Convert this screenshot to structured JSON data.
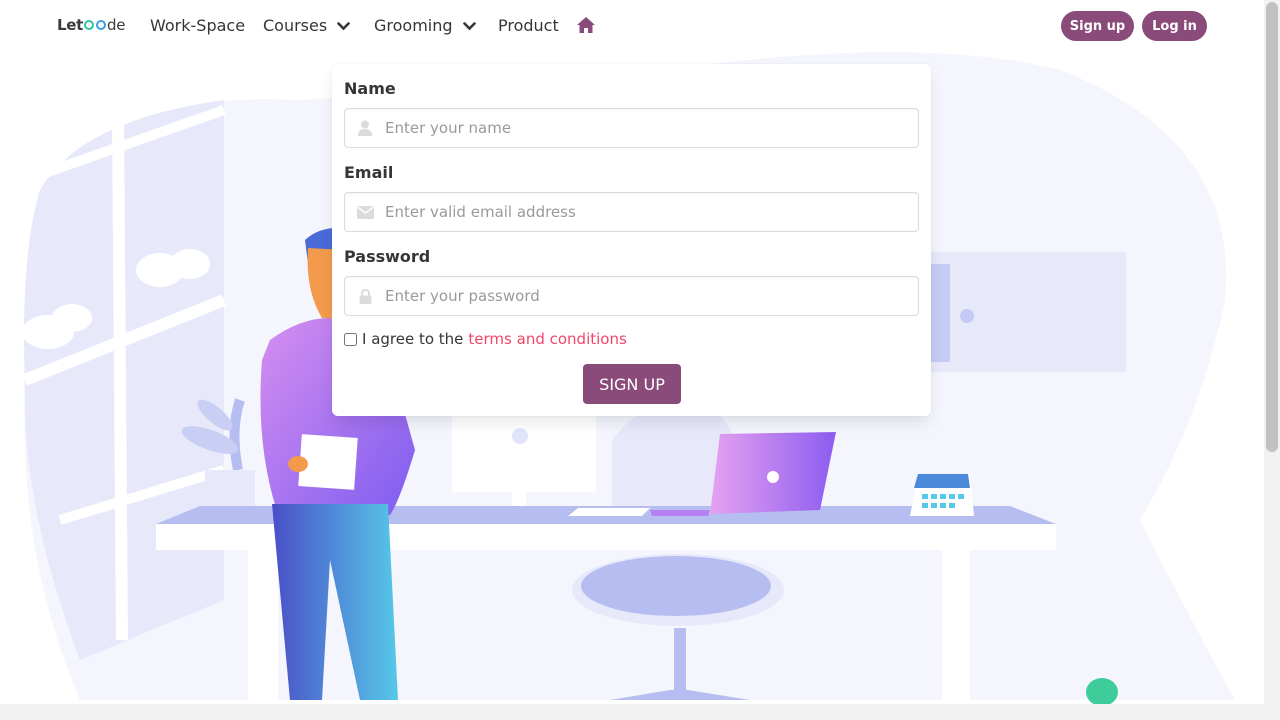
{
  "brand": {
    "logo_prefix": "Let",
    "logo_suffix": "de"
  },
  "nav": {
    "items": [
      {
        "label": "Work-Space"
      },
      {
        "label": "Courses"
      },
      {
        "label": "Grooming"
      },
      {
        "label": "Product"
      }
    ],
    "signup_label": "Sign up",
    "login_label": "Log in"
  },
  "form": {
    "name_label": "Name",
    "name_placeholder": "Enter your name",
    "email_label": "Email",
    "email_placeholder": "Enter valid email address",
    "password_label": "Password",
    "password_placeholder": "Enter your password",
    "agree_text": "I agree to the",
    "terms_link": "terms and conditions",
    "submit_label": "SIGN UP"
  },
  "icons": {
    "home": "home-icon",
    "user": "user-icon",
    "envelope": "envelope-icon",
    "lock": "lock-icon",
    "chevron": "chevron-down-icon"
  },
  "colors": {
    "accent": "#8a4b7a",
    "link": "#f14668",
    "brand_ring_green": "#2ec4a6",
    "brand_ring_blue": "#37a0e0"
  }
}
